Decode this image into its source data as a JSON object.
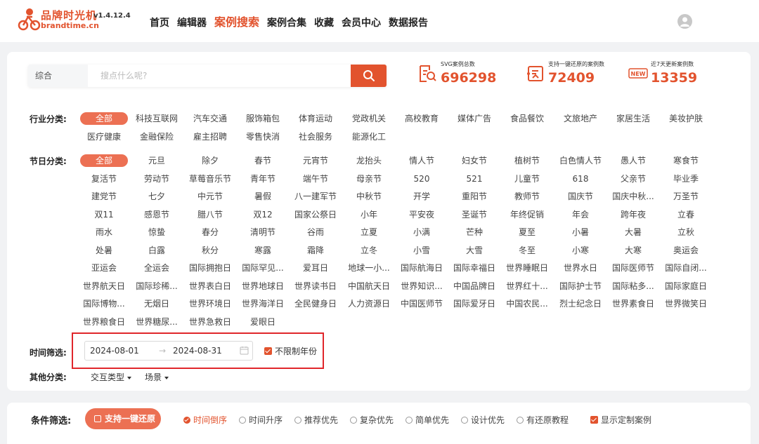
{
  "header": {
    "logo_name": "品牌时光机",
    "version": "v1.4.12.4",
    "domain": "brandtime.cn",
    "nav": [
      {
        "label": "首页"
      },
      {
        "label": "编辑器"
      },
      {
        "label": "案例搜索",
        "active": true
      },
      {
        "label": "案例合集"
      },
      {
        "label": "收藏"
      },
      {
        "label": "会员中心"
      },
      {
        "label": "数据报告"
      }
    ]
  },
  "search": {
    "type_label": "综合",
    "placeholder": "搜点什么呢?"
  },
  "stats": [
    {
      "label": "SVG案例总数",
      "value": "696298",
      "icon": "document-search-icon"
    },
    {
      "label": "支持一键还原的案例数",
      "value": "72409",
      "icon": "restore-icon"
    },
    {
      "label": "近7天更新案例数",
      "value": "13359",
      "icon": "new-badge-icon",
      "badge_text": "NEW"
    }
  ],
  "industry": {
    "label": "行业分类:",
    "tags": [
      "全部",
      "科技互联网",
      "汽车交通",
      "服饰箱包",
      "体育运动",
      "党政机关",
      "高校教育",
      "媒体广告",
      "食品餐饮",
      "文旅地产",
      "家居生活",
      "美妆护肤",
      "医疗健康",
      "金融保险",
      "雇主招聘",
      "零售快消",
      "社会服务",
      "能源化工"
    ]
  },
  "festival": {
    "label": "节日分类:",
    "tags": [
      "全部",
      "元旦",
      "除夕",
      "春节",
      "元宵节",
      "龙抬头",
      "情人节",
      "妇女节",
      "植树节",
      "白色情人节",
      "愚人节",
      "寒食节",
      "复活节",
      "劳动节",
      "草莓音乐节",
      "青年节",
      "端午节",
      "母亲节",
      "520",
      "521",
      "儿童节",
      "618",
      "父亲节",
      "毕业季",
      "建党节",
      "七夕",
      "中元节",
      "暑假",
      "八一建军节",
      "中秋节",
      "开学",
      "重阳节",
      "教师节",
      "国庆节",
      "国庆中秋...",
      "万圣节",
      "双11",
      "感恩节",
      "腊八节",
      "双12",
      "国家公祭日",
      "小年",
      "平安夜",
      "圣诞节",
      "年终促销",
      "年会",
      "跨年夜",
      "立春",
      "雨水",
      "惊蛰",
      "春分",
      "清明节",
      "谷雨",
      "立夏",
      "小满",
      "芒种",
      "夏至",
      "小暑",
      "大暑",
      "立秋",
      "处暑",
      "白露",
      "秋分",
      "寒露",
      "霜降",
      "立冬",
      "小雪",
      "大雪",
      "冬至",
      "小寒",
      "大寒",
      "奥运会",
      "亚运会",
      "全运会",
      "国际拥抱日",
      "国际罕见...",
      "爱耳日",
      "地球一小...",
      "国际航海日",
      "国际幸福日",
      "世界睡眠日",
      "世界水日",
      "国际医师节",
      "国际自闭...",
      "世界航天日",
      "国际珍稀...",
      "世界表白日",
      "世界地球日",
      "世界读书日",
      "中国航天日",
      "世界知识...",
      "中国品牌日",
      "世界红十...",
      "国际护士节",
      "国际粘多...",
      "国际家庭日",
      "国际博物...",
      "无烟日",
      "世界环境日",
      "世界海洋日",
      "全民健身日",
      "人力资源日",
      "中国医师节",
      "国际爱牙日",
      "中国农民...",
      "烈士纪念日",
      "世界素食日",
      "世界微笑日",
      "世界粮食日",
      "世界糖尿...",
      "世界急救日",
      "爱眼日"
    ]
  },
  "time_filter": {
    "label": "时间筛选:",
    "start": "2024-08-01",
    "end": "2024-08-31",
    "arrow": "→",
    "no_year_limit": "不限制年份",
    "no_year_checked": true
  },
  "other": {
    "label": "其他分类:",
    "dropdowns": [
      "交互类型",
      "场景"
    ]
  },
  "filter_bar": {
    "label": "条件筛选:",
    "restore_button": "支持一键还原",
    "sort_options": [
      {
        "label": "时间倒序",
        "active": true
      },
      {
        "label": "时间升序"
      },
      {
        "label": "推荐优先"
      },
      {
        "label": "复杂优先"
      },
      {
        "label": "简单优先"
      },
      {
        "label": "设计优先"
      },
      {
        "label": "有还原教程"
      }
    ],
    "show_custom": "显示定制案例",
    "show_custom_checked": true
  },
  "colors": {
    "accent": "#e2532e",
    "active_tag": "#ec7053",
    "highlight_border": "#e0262b"
  }
}
